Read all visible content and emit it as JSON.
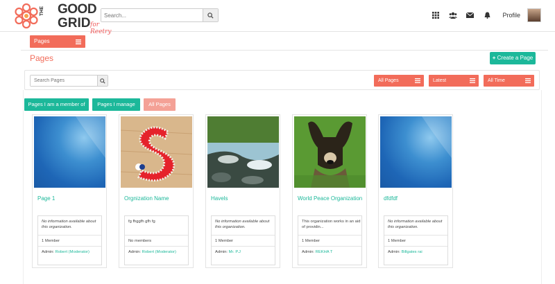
{
  "brand": {
    "the": "THE",
    "good": "GOOD",
    "grid": "GRID",
    "tagline": "for Reetry"
  },
  "header": {
    "search_placeholder": "Search...",
    "profile_label": "Profile",
    "icons": [
      "grid-icon",
      "users-icon",
      "envelope-icon",
      "bell-icon"
    ]
  },
  "colors": {
    "accent": "#f26c5a",
    "teal": "#1cb89a",
    "peach": "#f4a196"
  },
  "section": {
    "tag": "Pages",
    "title": "Pages",
    "create_button": "Create a Page"
  },
  "filters": {
    "search_placeholder": "Search Pages",
    "dropdowns": [
      "All Pages",
      "Latest",
      "All Time"
    ]
  },
  "tabs": [
    {
      "label": "Pages I am a member of",
      "active": false
    },
    {
      "label": "Pages I manage",
      "active": false
    },
    {
      "label": "All Pages",
      "active": true
    }
  ],
  "cards": [
    {
      "title": "Page 1",
      "description": "No information available about this organization.",
      "italic": true,
      "members": "1 Member",
      "admin_prefix": "Admin:",
      "admin": "Robert (Moderator)",
      "image": "blue-placeholder"
    },
    {
      "title": "Orgnization Name",
      "description": "fg fhggfh gfh fg",
      "italic": false,
      "members": "No members",
      "admin_prefix": "Admin:",
      "admin": "Robert (Moderator)",
      "image": "felt-letter-s"
    },
    {
      "title": "Havels",
      "description": "No information available about this organization.",
      "italic": true,
      "members": "1 Member",
      "admin_prefix": "Admin:",
      "admin": "Mr. P.J",
      "image": "river-rocks"
    },
    {
      "title": "World Peace Organization",
      "description": "This organization works in an aid of providin...",
      "italic": false,
      "members": "1 Member",
      "admin_prefix": "Admin:",
      "admin": "REKHA T",
      "image": "wild-dog"
    },
    {
      "title": "dfdfdf",
      "description": "No information available about this organization.",
      "italic": true,
      "members": "1 Member",
      "admin_prefix": "Admin:",
      "admin": "Billgates rai",
      "image": "blue-placeholder"
    }
  ]
}
